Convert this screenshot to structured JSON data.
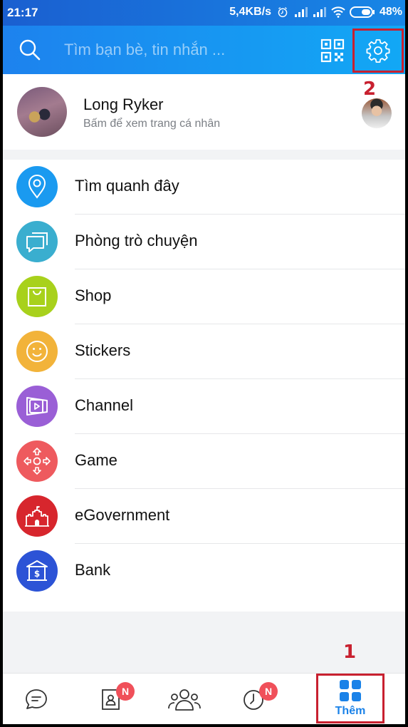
{
  "status_bar": {
    "time": "21:17",
    "network_speed": "5,4KB/s",
    "battery": "48%",
    "icons": [
      "alarm-icon",
      "signal-icon",
      "signal-icon",
      "wifi-icon",
      "battery-icon"
    ]
  },
  "header": {
    "search_placeholder": "Tìm bạn bè, tin nhắn ...",
    "icons": [
      "search-icon",
      "qr-code-icon",
      "gear-icon"
    ]
  },
  "profile": {
    "name": "Long Ryker",
    "subtitle": "Bấm để xem trang cá nhân"
  },
  "annotations": {
    "settings_step": "2",
    "more_tab_step": "1"
  },
  "menu": {
    "items": [
      {
        "label": "Tìm quanh đây",
        "icon": "location-pin-icon",
        "color": "#1a9af0"
      },
      {
        "label": "Phòng trò chuyện",
        "icon": "chat-rooms-icon",
        "color": "#3aaecf"
      },
      {
        "label": "Shop",
        "icon": "shopping-bag-icon",
        "color": "#a8d11c"
      },
      {
        "label": "Stickers",
        "icon": "smiley-icon",
        "color": "#f2b33a"
      },
      {
        "label": "Channel",
        "icon": "video-channel-icon",
        "color": "#9a5fd6"
      },
      {
        "label": "Game",
        "icon": "gamepad-icon",
        "color": "#ee5a5e"
      },
      {
        "label": "eGovernment",
        "icon": "castle-icon",
        "color": "#d7262d"
      },
      {
        "label": "Bank",
        "icon": "bank-icon",
        "color": "#2c53d6"
      }
    ]
  },
  "bottom_nav": {
    "tabs": [
      {
        "name": "messages",
        "icon": "chat-bubble-icon"
      },
      {
        "name": "contacts",
        "icon": "contact-book-icon",
        "badge": "N"
      },
      {
        "name": "groups",
        "icon": "group-icon"
      },
      {
        "name": "timeline",
        "icon": "clock-icon",
        "badge": "N"
      },
      {
        "name": "more",
        "icon": "grid-icon",
        "label": "Thêm",
        "active": true
      }
    ],
    "active_color": "#1a82e8"
  }
}
